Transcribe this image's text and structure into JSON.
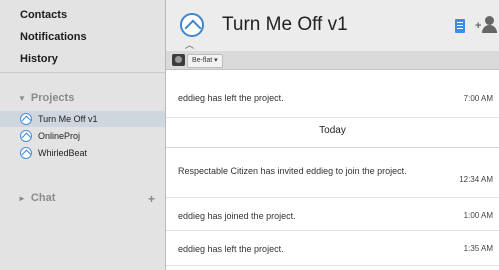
{
  "sidebar": {
    "nav": [
      "Contacts",
      "Notifications",
      "History"
    ],
    "projects_label": "Projects",
    "projects": [
      "Turn Me Off v1",
      "OnlineProj",
      "WhirledBeat"
    ],
    "chat_label": "Chat",
    "chat_add": "+"
  },
  "header": {
    "title": "Turn Me Off v1",
    "add_symbol": "+"
  },
  "toolbar": {
    "branch": "Be-flat ▾"
  },
  "feed": {
    "separator": "Today",
    "events": [
      {
        "text": "eddieg has left the project.",
        "time": "7:00 AM"
      },
      {
        "text": "Respectable Citizen has invited eddieg to join the project.",
        "time": "12:34 AM"
      },
      {
        "text": "eddieg has joined the project.",
        "time": "1:00 AM"
      },
      {
        "text": "eddieg has left the project.",
        "time": "1:35 AM"
      }
    ]
  }
}
